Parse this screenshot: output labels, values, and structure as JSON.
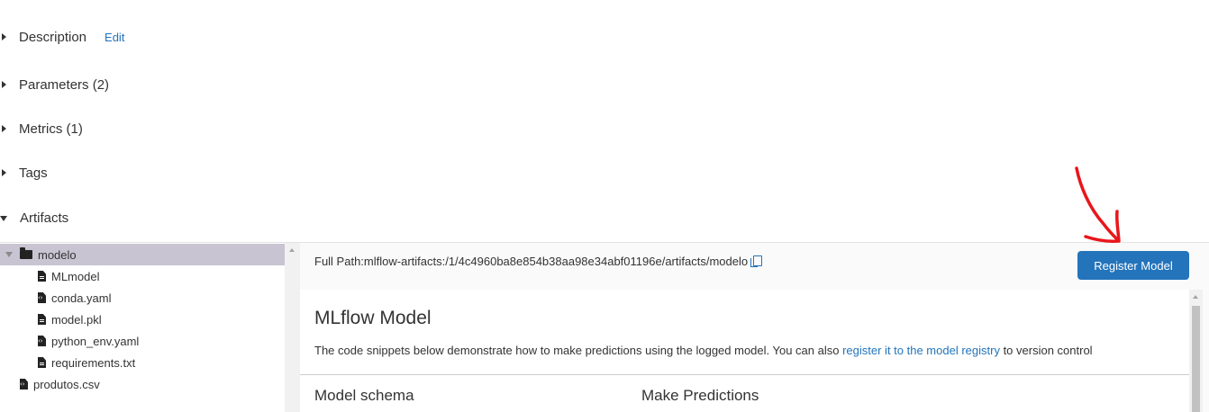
{
  "sections": [
    {
      "title": "Description",
      "expanded": false,
      "action": "Edit"
    },
    {
      "title": "Parameters (2)",
      "expanded": false
    },
    {
      "title": "Metrics (1)",
      "expanded": false
    },
    {
      "title": "Tags",
      "expanded": false
    },
    {
      "title": "Artifacts",
      "expanded": true
    }
  ],
  "artifacts": {
    "tree": {
      "root_folder": "modelo",
      "children": [
        "MLmodel",
        "conda.yaml",
        "model.pkl",
        "python_env.yaml",
        "requirements.txt"
      ],
      "siblings": [
        "produtos.csv"
      ]
    },
    "full_path_label": "Full Path:",
    "full_path_value": "mlflow-artifacts:/1/4c4960ba8e854b38aa98e34abf01196e/artifacts/modelo",
    "register_button": "Register Model",
    "model_card": {
      "title": "MLflow Model",
      "desc_before": "The code snippets below demonstrate how to make predictions using the logged model. You can also ",
      "desc_link": "register it to the model registry",
      "desc_after": " to version control",
      "col_schema": "Model schema",
      "col_predictions": "Make Predictions"
    }
  },
  "colors": {
    "accent": "#2374bb",
    "selected_row": "#c9c4d2",
    "annotation": "#e8161b"
  }
}
